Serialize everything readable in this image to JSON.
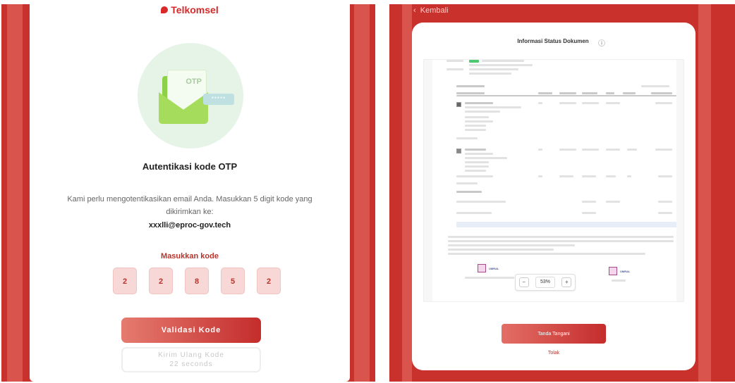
{
  "left": {
    "brand": "Telkomsel",
    "otp_illustration_text": "OTP",
    "password_mask": "*****",
    "title": "Autentikasi kode OTP",
    "description": "Kami perlu mengotentikasikan email Anda. Masukkan 5 digit kode yang dikirimkan ke:",
    "email": "xxxlli@eproc-gov.tech",
    "code_label": "Masukkan kode",
    "otp_digits": [
      "2",
      "2",
      "8",
      "5",
      "2"
    ],
    "validate_button": "Validasi Kode",
    "resend_button": "Kirim Ulang Kode",
    "resend_timer": "22 seconds"
  },
  "right": {
    "back_label": "Kembali",
    "header_title": "Informasi Status Dokumen",
    "zoom_level": "53%",
    "sign_button": "Tanda Tangani",
    "reject_link": "Tolak",
    "signatory_left": "UMRAL",
    "signatory_right": "UMRAL"
  },
  "colors": {
    "brand_red": "#c9322c",
    "otp_box_bg": "#f7d8d6",
    "accent_green": "#8dd04a"
  },
  "icons": {
    "brand": "telkomsel-logo-icon",
    "back": "chevron-left-icon",
    "info": "info-icon",
    "zoom_out": "zoom-out-icon",
    "zoom_in": "zoom-in-icon"
  }
}
